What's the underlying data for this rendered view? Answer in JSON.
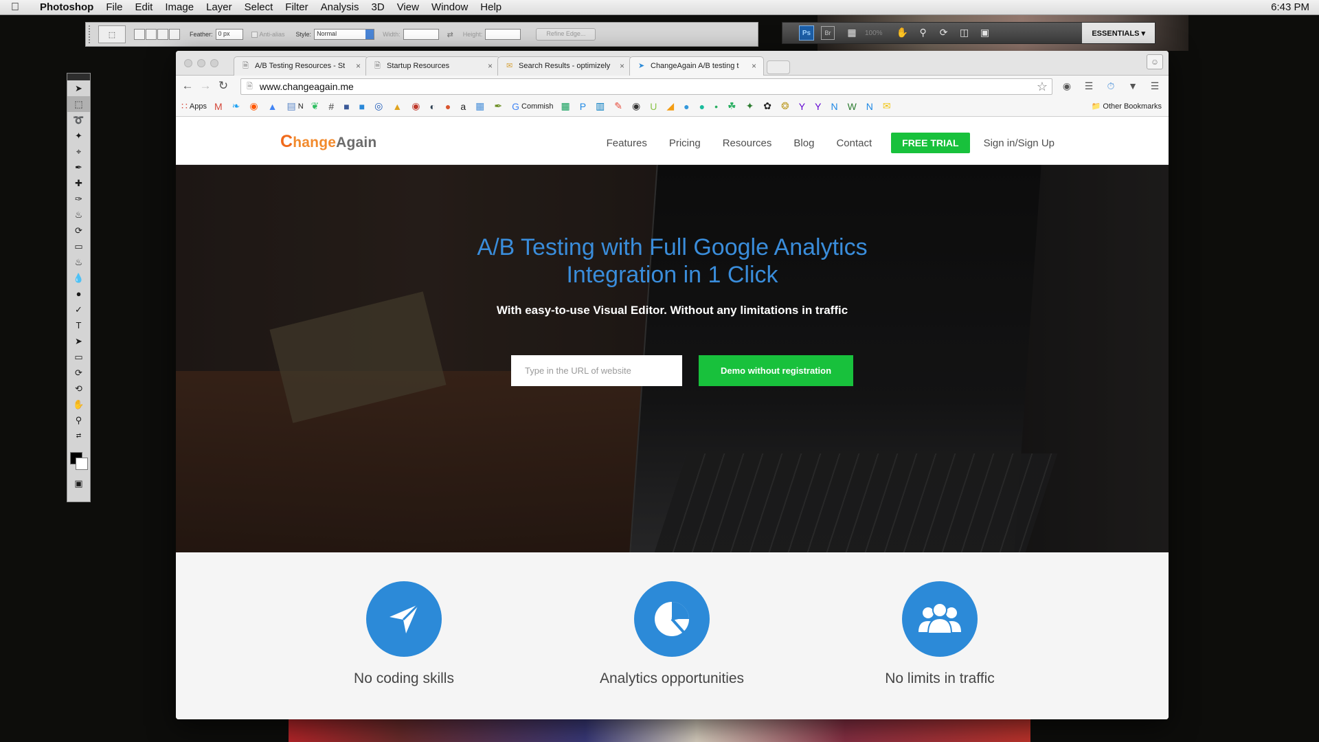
{
  "menubar": {
    "app": "Photoshop",
    "items": [
      "File",
      "Edit",
      "Image",
      "Layer",
      "Select",
      "Filter",
      "Analysis",
      "3D",
      "View",
      "Window",
      "Help"
    ],
    "clock": "6:43 PM"
  },
  "ps_options": {
    "feather_label": "Feather:",
    "feather_value": "0 px",
    "antialias_label": "Anti-alias",
    "style_label": "Style:",
    "style_value": "Normal",
    "width_label": "Width:",
    "height_label": "Height:",
    "refine_label": "Refine Edge..."
  },
  "ps_appbar": {
    "ps_label": "Ps",
    "br_label": "Br",
    "zoom": "100%",
    "workspace": "ESSENTIALS ▾"
  },
  "browser": {
    "tabs": [
      {
        "title": "A/B Testing Resources - St",
        "icon": "doc-icon"
      },
      {
        "title": "Startup Resources",
        "icon": "doc-icon"
      },
      {
        "title": "Search Results - optimizely",
        "icon": "mail-icon"
      },
      {
        "title": "ChangeAgain A/B testing t",
        "icon": "changeagain-icon"
      }
    ],
    "url": "www.changeagain.me",
    "bookmarks": [
      {
        "label": "Apps",
        "icon": "apps-grid-icon",
        "color": "#d44638"
      },
      {
        "label": "",
        "icon": "gmail-icon",
        "color": "#d44638"
      },
      {
        "label": "",
        "icon": "twitter-icon",
        "color": "#1da1f2"
      },
      {
        "label": "",
        "icon": "reddit-icon",
        "color": "#ff5700"
      },
      {
        "label": "",
        "icon": "drive-icon",
        "color": "#4285f4"
      },
      {
        "label": "N",
        "icon": "folder-icon",
        "color": "#5a86c6"
      },
      {
        "label": "",
        "icon": "evernote-icon",
        "color": "#2dbe60"
      },
      {
        "label": "",
        "icon": "hashtag-icon",
        "color": "#444444"
      },
      {
        "label": "",
        "icon": "square-icon",
        "color": "#3b5998"
      },
      {
        "label": "",
        "icon": "blue-square-icon",
        "color": "#2a88d8"
      },
      {
        "label": "",
        "icon": "lifebuoy-icon",
        "color": "#1e5bb8"
      },
      {
        "label": "",
        "icon": "mountain-icon",
        "color": "#e0a31e"
      },
      {
        "label": "",
        "icon": "target-icon",
        "color": "#c0392b"
      },
      {
        "label": "",
        "icon": "moon-icon",
        "color": "#2c3e50"
      },
      {
        "label": "",
        "icon": "ph-icon",
        "color": "#da552f"
      },
      {
        "label": "",
        "icon": "amazon-icon",
        "color": "#222222"
      },
      {
        "label": "",
        "icon": "calendar-icon",
        "color": "#4a90d9"
      },
      {
        "label": "",
        "icon": "feather-icon",
        "color": "#6b8e23"
      },
      {
        "label": "Commish",
        "icon": "google-icon",
        "color": "#4285f4"
      },
      {
        "label": "",
        "icon": "sheets-icon",
        "color": "#0f9d58"
      },
      {
        "label": "",
        "icon": "p-icon",
        "color": "#1e88e5"
      },
      {
        "label": "",
        "icon": "trello-icon",
        "color": "#0079bf"
      },
      {
        "label": "",
        "icon": "pen-icon",
        "color": "#e74c3c"
      },
      {
        "label": "",
        "icon": "camera-icon",
        "color": "#333333"
      },
      {
        "label": "",
        "icon": "u-icon",
        "color": "#8bc34a"
      },
      {
        "label": "",
        "icon": "chart-icon",
        "color": "#f39c12"
      },
      {
        "label": "",
        "icon": "drop-icon",
        "color": "#3498db"
      },
      {
        "label": "",
        "icon": "bubble-icon",
        "color": "#1abc9c"
      },
      {
        "label": "",
        "icon": "dot-icon",
        "color": "#27ae60"
      },
      {
        "label": "",
        "icon": "leaf-icon",
        "color": "#27ae60"
      },
      {
        "label": "",
        "icon": "puzzle-icon",
        "color": "#2e7d32"
      },
      {
        "label": "",
        "icon": "paw-icon",
        "color": "#222222"
      },
      {
        "label": "",
        "icon": "badge-icon",
        "color": "#c0a030"
      },
      {
        "label": "",
        "icon": "yahoo-icon",
        "color": "#5f01d1"
      },
      {
        "label": "",
        "icon": "yahoo-icon",
        "color": "#5f01d1"
      },
      {
        "label": "",
        "icon": "n-icon",
        "color": "#1e88e5"
      },
      {
        "label": "",
        "icon": "w-icon",
        "color": "#2e7d32"
      },
      {
        "label": "",
        "icon": "n-icon",
        "color": "#1e88e5"
      },
      {
        "label": "",
        "icon": "envelope-icon",
        "color": "#f1c40f"
      }
    ],
    "other_bookmarks": "Other Bookmarks"
  },
  "site": {
    "logo": {
      "c": "C",
      "change": "hange",
      "again": "Again"
    },
    "nav": [
      "Features",
      "Pricing",
      "Resources",
      "Blog",
      "Contact"
    ],
    "trial_label": "FREE TRIAL",
    "signin_label": "Sign in/Sign Up",
    "hero": {
      "title_line1": "A/B Testing with Full Google Analytics",
      "title_line2": "Integration in 1 Click",
      "subtitle": "With easy-to-use Visual Editor. Without any limitations in traffic",
      "url_placeholder": "Type in the URL of website",
      "demo_label": "Demo without registration"
    },
    "features": [
      {
        "label": "No coding skills",
        "icon": "paper-plane-icon"
      },
      {
        "label": "Analytics opportunities",
        "icon": "pie-chart-icon"
      },
      {
        "label": "No limits in traffic",
        "icon": "users-icon"
      }
    ],
    "accent": "#2c8ad8",
    "cta_color": "#18c13c"
  }
}
